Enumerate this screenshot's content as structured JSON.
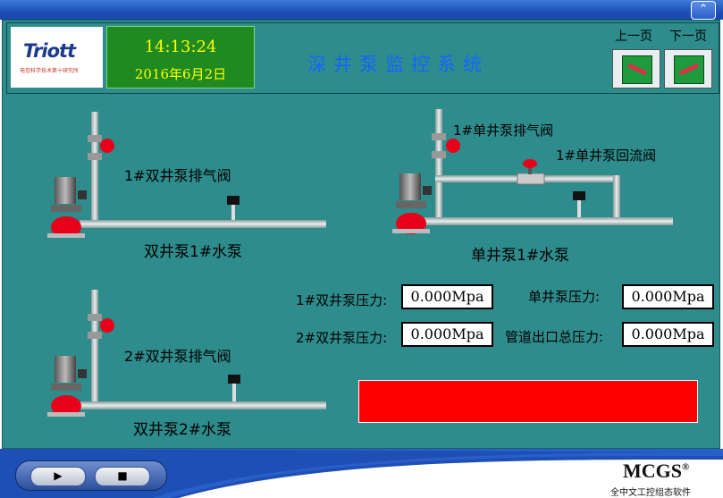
{
  "window": {
    "close_label": "⌃"
  },
  "header": {
    "logo": "Triott",
    "logo_sub": "电信科学技术第十研究所",
    "time": "14:13:24",
    "date": "2016年6月2日",
    "title": "深井泵监控系统",
    "prev_page": "上一页",
    "next_page": "下一页"
  },
  "pumps": {
    "pump1": {
      "label": "双井泵1#水泵",
      "valve": "1#双井泵排气阀"
    },
    "pump_single": {
      "label": "单井泵1#水泵",
      "valve": "1#单井泵排气阀",
      "return_valve": "1#单井泵回流阀"
    },
    "pump2": {
      "label": "双井泵2#水泵",
      "valve": "2#双井泵排气阀"
    }
  },
  "readings": {
    "r1": {
      "label": "1#双井泵压力:",
      "value": "0.000Mpa"
    },
    "r2": {
      "label": "单井泵压力:",
      "value": "0.000Mpa"
    },
    "r3": {
      "label": "2#双井泵压力:",
      "value": "0.000Mpa"
    },
    "r4": {
      "label": "管道出口总压力:",
      "value": "0.000Mpa"
    }
  },
  "alarm_color": "#ff0000",
  "taskbar": {
    "play_label": "▶",
    "stop_label": "■",
    "brand": "MCGS",
    "brand_reg": "®",
    "brand_sub": "全中文工控组态软件"
  }
}
